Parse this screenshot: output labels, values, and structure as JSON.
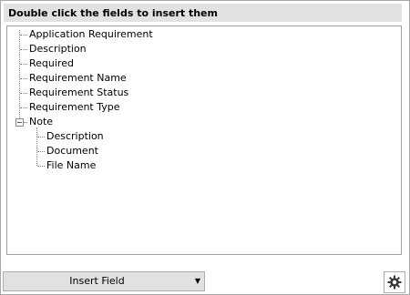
{
  "header": {
    "title": "Double click the fields to insert them"
  },
  "tree": {
    "items": [
      {
        "label": "Application Requirement"
      },
      {
        "label": "Description"
      },
      {
        "label": "Required"
      },
      {
        "label": "Requirement Name"
      },
      {
        "label": "Requirement Status"
      },
      {
        "label": "Requirement Type"
      },
      {
        "label": "Note",
        "expanded": true,
        "children": [
          {
            "label": "Description"
          },
          {
            "label": "Document"
          },
          {
            "label": "File Name"
          }
        ]
      }
    ]
  },
  "footer": {
    "insert_label": "Insert Field",
    "insert_caret": "▼",
    "settings_icon": "gear-icon"
  }
}
